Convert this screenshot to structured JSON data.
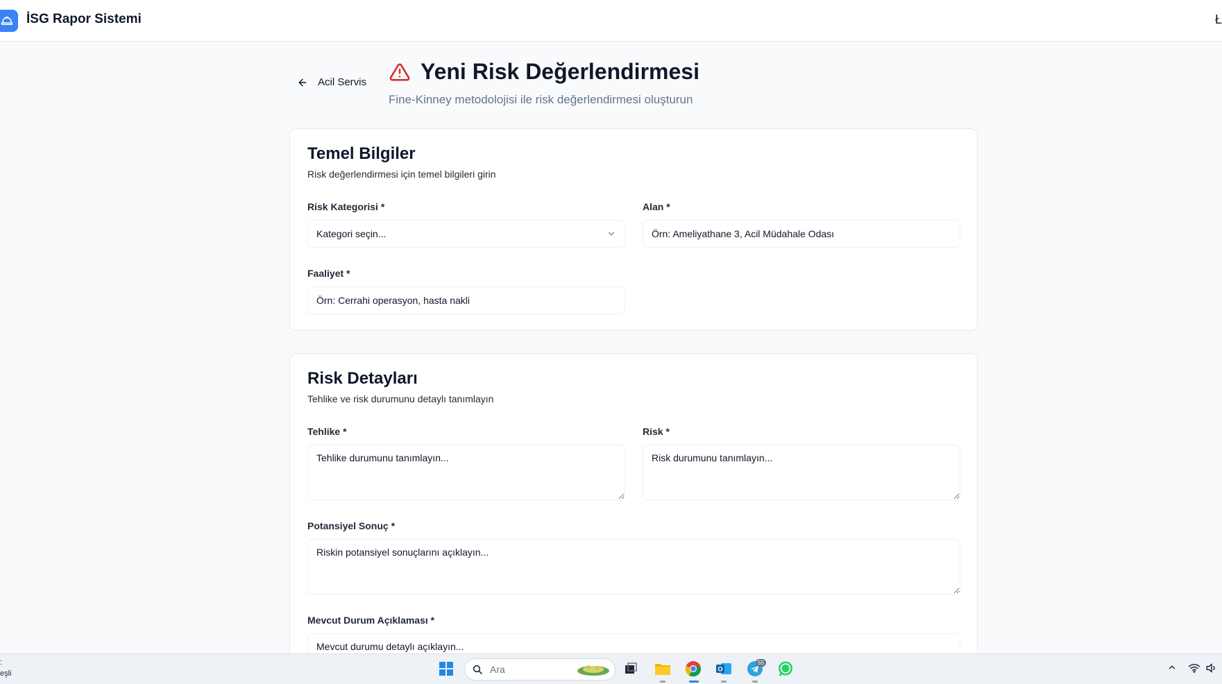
{
  "app": {
    "title": "İSG Rapor Sistemi",
    "edge_glyph": "Ł"
  },
  "back": {
    "label": "Acil Servis"
  },
  "page": {
    "title": "Yeni Risk Değerlendirmesi",
    "subtitle": "Fine-Kinney metodolojisi ile risk değerlendirmesi oluşturun"
  },
  "basic": {
    "title": "Temel Bilgiler",
    "description": "Risk değerlendirmesi için temel bilgileri girin",
    "category_label": "Risk Kategorisi *",
    "category_placeholder": "Kategori seçin...",
    "area_label": "Alan *",
    "area_placeholder": "Örn: Ameliyathane 3, Acil Müdahale Odası",
    "activity_label": "Faaliyet *",
    "activity_placeholder": "Örn: Cerrahi operasyon, hasta nakli"
  },
  "details": {
    "title": "Risk Detayları",
    "description": "Tehlike ve risk durumunu detaylı tanımlayın",
    "hazard_label": "Tehlike *",
    "hazard_placeholder": "Tehlike durumunu tanımlayın...",
    "risk_label": "Risk *",
    "risk_placeholder": "Risk durumunu tanımlayın...",
    "consequence_label": "Potansiyel Sonuç *",
    "consequence_placeholder": "Riskin potansiyel sonuçlarını açıklayın...",
    "current_label": "Mevcut Durum Açıklaması *",
    "current_placeholder": "Mevcut durumu detaylı açıklayın..."
  },
  "taskbar": {
    "left_top": ":",
    "left_bottom": "eşli",
    "search_placeholder": "Ara",
    "telegram_badge": "55"
  },
  "colors": {
    "brand": "#3b82f6",
    "warning": "#dc2626",
    "card_border": "#e5e7eb",
    "muted_text": "#64748b"
  }
}
